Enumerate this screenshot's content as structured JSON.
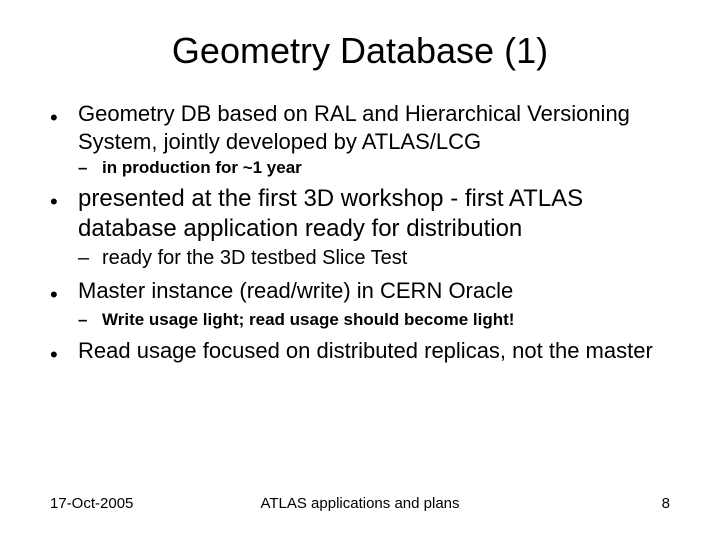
{
  "title": "Geometry Database (1)",
  "bullets": {
    "b1": "Geometry DB based on RAL and Hierarchical Versioning System, jointly developed by ATLAS/LCG",
    "b1_sub1": "in production for ~1 year",
    "b2": "presented at the first 3D workshop - first ATLAS database application ready for distribution",
    "b2_sub1": "ready for the 3D testbed Slice Test",
    "b3": "Master instance (read/write) in CERN Oracle",
    "b3_sub1": "Write usage light; read usage should become light!",
    "b4": "Read usage focused on distributed replicas, not the master"
  },
  "footer": {
    "date": "17-Oct-2005",
    "center": "ATLAS applications and plans",
    "page": "8"
  }
}
